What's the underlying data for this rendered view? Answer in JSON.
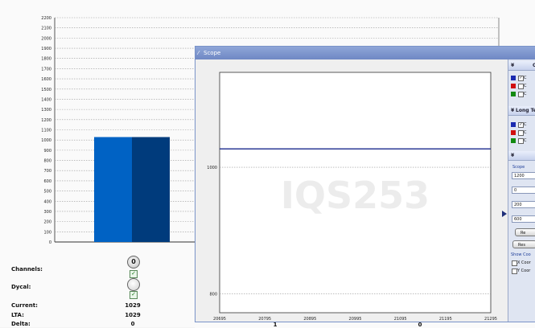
{
  "bar_chart": {
    "y_ticks": [
      "2200",
      "2100",
      "2000",
      "1900",
      "1800",
      "1700",
      "1600",
      "1500",
      "1400",
      "1300",
      "1200",
      "1100",
      "1000",
      "900",
      "800",
      "700",
      "600",
      "500",
      "400",
      "300",
      "200",
      "100",
      "0"
    ],
    "bar_values": [
      1029,
      1029
    ],
    "bar_colors": [
      "#0062c4",
      "#003b7c"
    ]
  },
  "metrics": {
    "channels_label": "Channels:",
    "channels_knob": "0",
    "dycal_label": "Dycal:",
    "current_label": "Current:",
    "current_value": "1029",
    "lta_label": "LTA:",
    "lta_value": "1029",
    "delta_label": "Delta:",
    "delta_value": "0"
  },
  "bottom_row": {
    "value_1": "1",
    "value_2": "0"
  },
  "scope": {
    "title": "Scope",
    "y_ticks": [
      "1000",
      "800"
    ],
    "x_ticks": [
      "20695",
      "20795",
      "20895",
      "20995",
      "21095",
      "21195",
      "21295"
    ],
    "watermark": "IQS253",
    "line_color": "#1a2a8c",
    "line_value": 1029
  },
  "side_panel": {
    "section1_title": "Cı",
    "section1_items": [
      "C",
      "C",
      "C"
    ],
    "section2_title": "Long Te",
    "section2_items": [
      "C",
      "C",
      "C"
    ],
    "scope_label": "Scope",
    "fields": [
      "1200",
      "0",
      "200",
      "600"
    ],
    "btn1": "Re",
    "btn2": "Res",
    "show_coords_label": "Show Coo",
    "x_coord_label": "X Coor",
    "y_coord_label": "Y Coor"
  }
}
